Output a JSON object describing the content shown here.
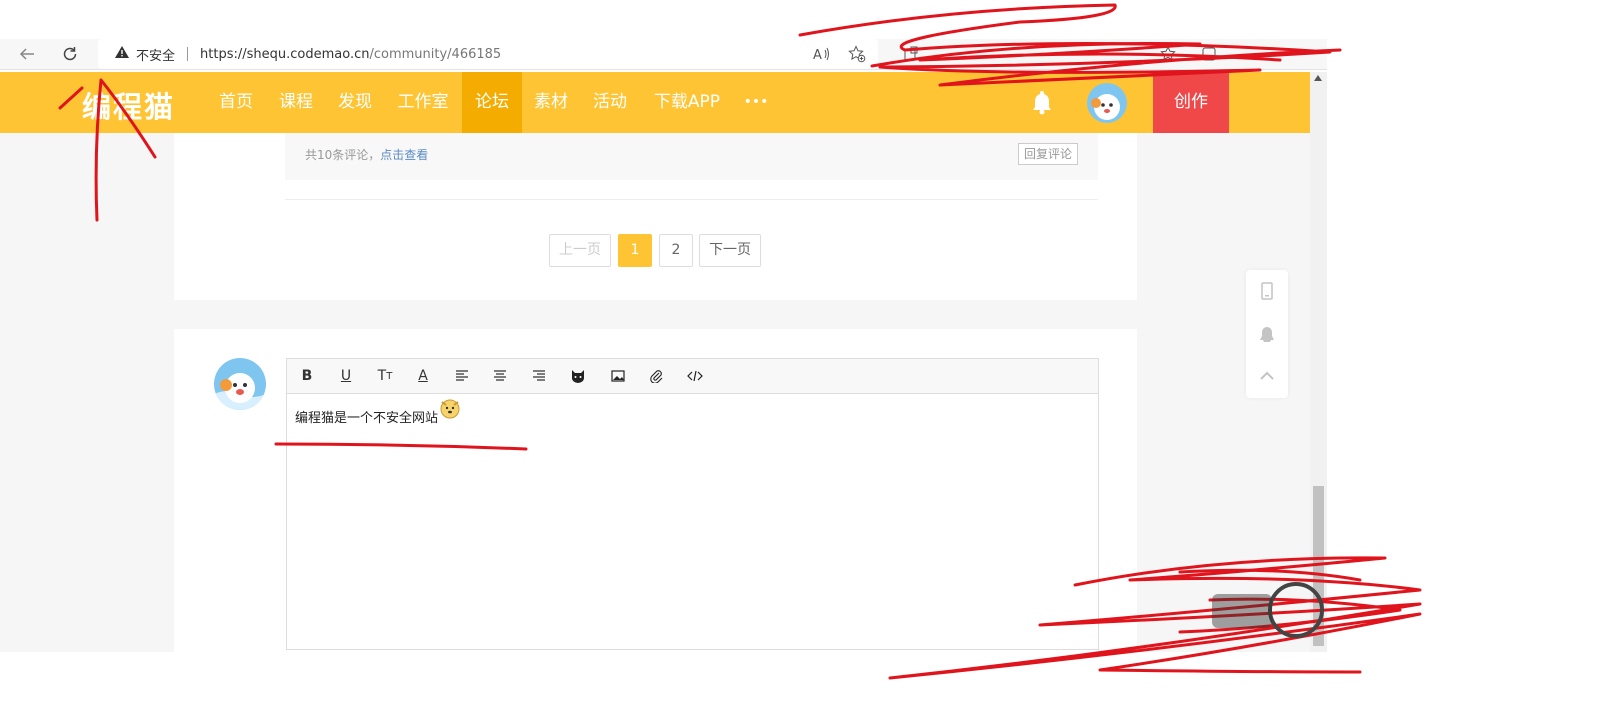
{
  "browser": {
    "security_label": "不安全",
    "url_host": "https://shequ.codemao.cn",
    "url_path": "/community/466185"
  },
  "site": {
    "logo_text": "编程猫",
    "nav": [
      "首页",
      "课程",
      "发现",
      "工作室",
      "论坛",
      "素材",
      "活动",
      "下载APP",
      "•••"
    ],
    "active_nav": "论坛",
    "create_label": "创作",
    "brand_color": "#fec433",
    "create_color": "#f04848"
  },
  "comments": {
    "count_text": "共10条评论，",
    "view_link": "点击查看",
    "reply_label": "回复评论"
  },
  "pagination": {
    "prev": "上一页",
    "pages": [
      "1",
      "2"
    ],
    "current": "1",
    "next": "下一页"
  },
  "editor": {
    "tools": [
      "bold",
      "underline",
      "font-size",
      "font-color",
      "align-left",
      "align-center",
      "align-right",
      "emoji-cat",
      "image",
      "attachment",
      "code"
    ],
    "content": "编程猫是一个不安全网站"
  }
}
